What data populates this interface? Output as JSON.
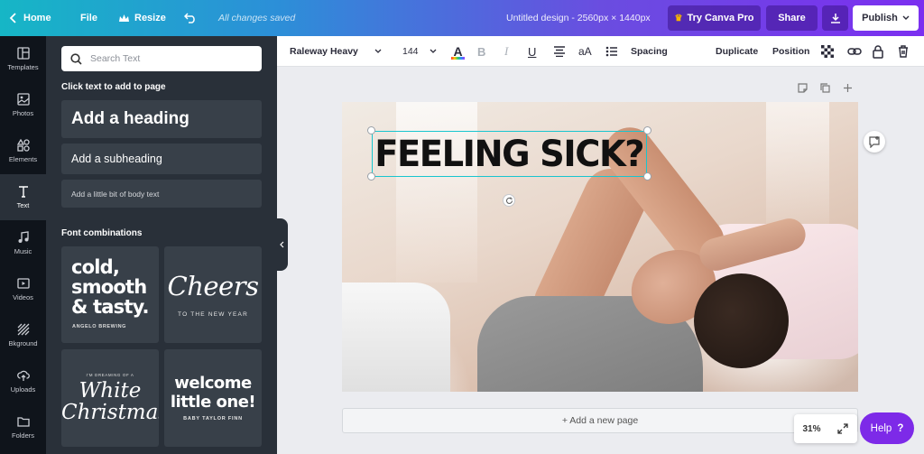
{
  "topbar": {
    "home": "Home",
    "file": "File",
    "resize": "Resize",
    "saved": "All changes saved",
    "title": "Untitled design - 2560px × 1440px",
    "try_pro": "Try Canva Pro",
    "share": "Share",
    "publish": "Publish"
  },
  "rail": {
    "items": [
      {
        "label": "Templates",
        "icon": "templates-icon"
      },
      {
        "label": "Photos",
        "icon": "photos-icon"
      },
      {
        "label": "Elements",
        "icon": "elements-icon"
      },
      {
        "label": "Text",
        "icon": "text-icon"
      },
      {
        "label": "Music",
        "icon": "music-icon"
      },
      {
        "label": "Videos",
        "icon": "videos-icon"
      },
      {
        "label": "Bkground",
        "icon": "background-icon"
      },
      {
        "label": "Uploads",
        "icon": "uploads-icon"
      },
      {
        "label": "Folders",
        "icon": "folders-icon"
      }
    ],
    "active": "Text"
  },
  "panel": {
    "search_placeholder": "Search Text",
    "click_text_title": "Click text to add to page",
    "heading": "Add a heading",
    "subheading": "Add a subheading",
    "body": "Add a little bit of body text",
    "font_combinations_title": "Font combinations",
    "combos": [
      {
        "line1": "cold,",
        "line2": "smooth",
        "line3": "& tasty.",
        "small": "ANGELO BREWING"
      },
      {
        "line1": "Cheers",
        "small": "TO THE NEW YEAR"
      },
      {
        "top": "I'M DREAMING OF A",
        "line1": "White",
        "line2": "Christmas"
      },
      {
        "line1": "welcome",
        "line2": "little one!",
        "small": "BABY TAYLOR FINN"
      }
    ]
  },
  "toolbar": {
    "font": "Raleway Heavy",
    "size": "144",
    "color_glyph": "A",
    "bold": "B",
    "italic": "I",
    "underline": "U",
    "case": "aA",
    "spacing": "Spacing",
    "duplicate": "Duplicate",
    "position": "Position"
  },
  "canvas": {
    "headline": "FEELING SICK?",
    "add_page": "+ Add a new page",
    "zoom": "31%"
  },
  "help": {
    "label": "Help",
    "glyph": "?"
  },
  "colors": {
    "accent": "#7d2ae8",
    "selection": "#18c5cf",
    "panel": "#293039",
    "rail": "#0f141b"
  }
}
